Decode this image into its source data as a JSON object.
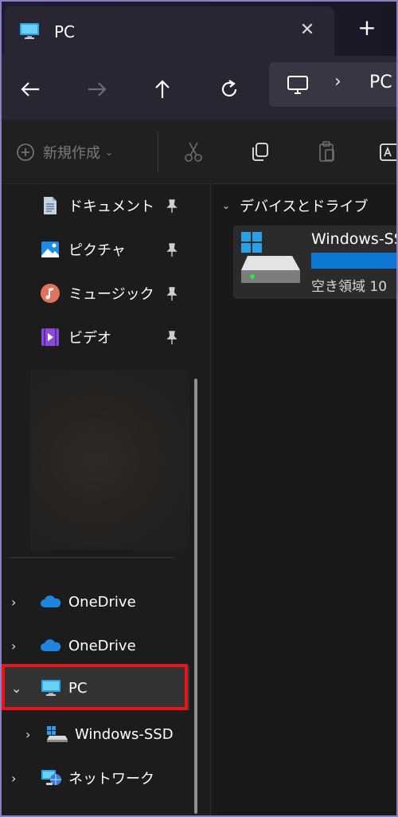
{
  "window": {
    "tab_title": "PC",
    "tab_close": "✕",
    "new_tab": "+"
  },
  "nav": {
    "back_icon": "arrow-left-icon",
    "forward_icon": "arrow-right-icon",
    "up_icon": "arrow-up-icon",
    "refresh_icon": "refresh-icon",
    "address": {
      "icon": "monitor-icon",
      "separator": "›",
      "location": "PC"
    }
  },
  "toolbar": {
    "new_label": "新規作成",
    "new_icon": "plus-circle-icon",
    "new_chevron": "⌄"
  },
  "sidebar": {
    "quick_access": [
      {
        "label": "ドキュメント",
        "icon": "document-icon"
      },
      {
        "label": "ピクチャ",
        "icon": "pictures-icon"
      },
      {
        "label": "ミュージック",
        "icon": "music-icon"
      },
      {
        "label": "ビデオ",
        "icon": "video-icon"
      }
    ],
    "tree": [
      {
        "label": "OneDrive",
        "caret": "›",
        "icon": "onedrive-icon"
      },
      {
        "label": "OneDrive",
        "caret": "›",
        "icon": "onedrive-icon"
      },
      {
        "label": "PC",
        "caret": "⌄",
        "icon": "monitor-icon",
        "selected": true
      },
      {
        "label": "Windows-SSD",
        "caret": "›",
        "icon": "drive-icon"
      },
      {
        "label": "ネットワーク",
        "caret": "›",
        "icon": "network-icon"
      }
    ]
  },
  "content": {
    "group_title": "デバイスとドライブ",
    "group_chevron": "⌄",
    "drive": {
      "name": "Windows-SSD",
      "free_text": "空き領域 10",
      "usage_fraction": 0.85
    }
  },
  "colors": {
    "accent": "#0e78d6",
    "highlight": "#e8141a",
    "titlebar": "#201a33"
  }
}
